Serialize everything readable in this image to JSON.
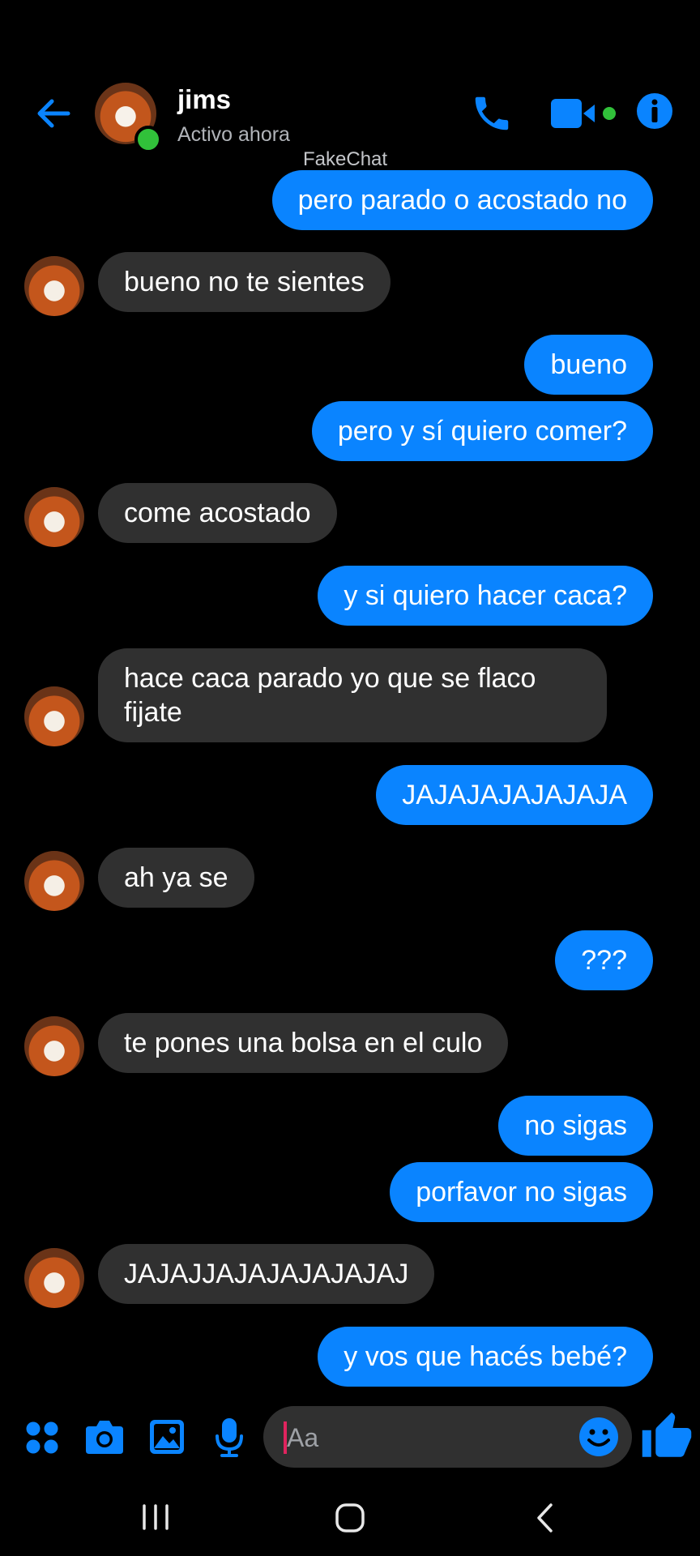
{
  "header": {
    "contact_name": "jims",
    "status": "Activo ahora",
    "watermark": "FakeChat",
    "icons": [
      "back-arrow-icon",
      "phone-icon",
      "video-camera-icon",
      "info-icon"
    ],
    "online": true
  },
  "colors": {
    "accent": "#0A84FF",
    "incoming_bubble": "#303030",
    "background": "#000000",
    "online": "#31C13A"
  },
  "messages": [
    {
      "dir": "out",
      "text": "pero parado o acostado no"
    },
    {
      "dir": "in",
      "text": "bueno no te sientes"
    },
    {
      "dir": "out",
      "text": "bueno"
    },
    {
      "dir": "out",
      "text": "pero y sí quiero comer?"
    },
    {
      "dir": "in",
      "text": "come acostado"
    },
    {
      "dir": "out",
      "text": "y si quiero hacer caca?"
    },
    {
      "dir": "in",
      "text": "hace caca parado yo que se flaco fijate"
    },
    {
      "dir": "out",
      "text": "JAJAJAJAJAJAJA"
    },
    {
      "dir": "in",
      "text": "ah ya se"
    },
    {
      "dir": "out",
      "text": "???"
    },
    {
      "dir": "in",
      "text": "te pones una bolsa en el culo"
    },
    {
      "dir": "out",
      "text": "no sigas"
    },
    {
      "dir": "out",
      "text": "porfavor no sigas"
    },
    {
      "dir": "in",
      "text": "JAJAJJAJAJAJAJAJAJ"
    },
    {
      "dir": "out",
      "text": "y vos que hacés bebé?"
    }
  ],
  "composer": {
    "placeholder": "Aa",
    "icons": [
      "apps-grid-icon",
      "camera-icon",
      "gallery-icon",
      "microphone-icon",
      "emoji-icon",
      "thumbs-up-icon"
    ]
  },
  "navbar": {
    "icons": [
      "recent-apps-icon",
      "home-icon",
      "back-nav-icon"
    ]
  }
}
